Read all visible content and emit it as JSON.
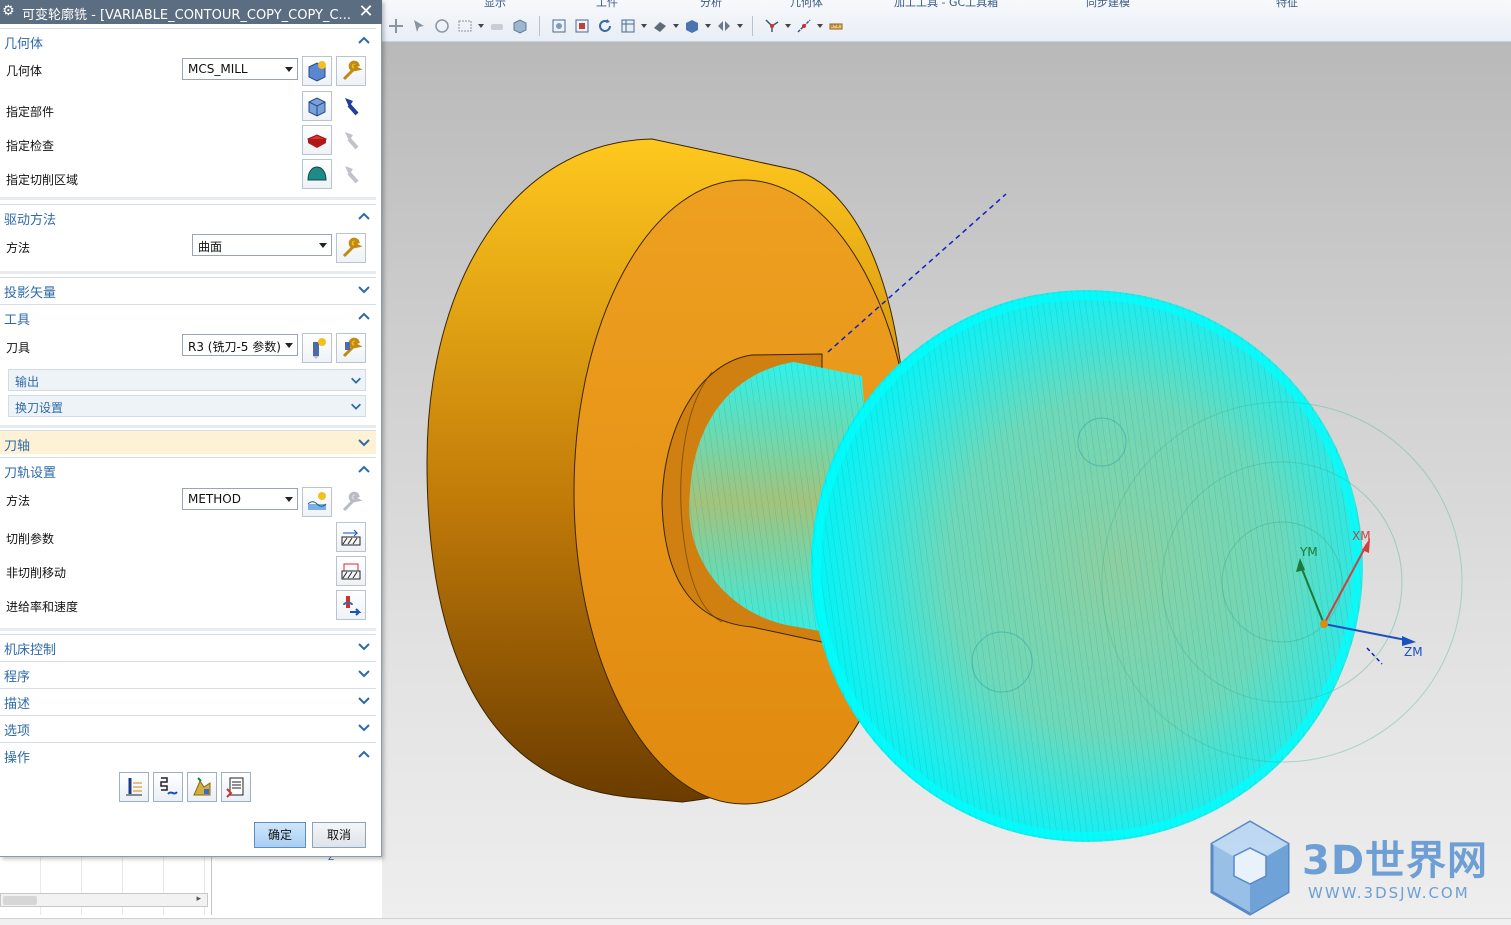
{
  "dialog": {
    "title": "可变轮廓铣 - [VARIABLE_CONTOUR_COPY_COPY_C...",
    "close_label": "✕",
    "sections": {
      "geometry": {
        "title": "几何体",
        "geometry_label": "几何体",
        "geometry_value": "MCS_MILL",
        "specify_part": "指定部件",
        "specify_check": "指定检查",
        "specify_cut_area": "指定切削区域"
      },
      "drive": {
        "title": "驱动方法",
        "method_label": "方法",
        "method_value": "曲面"
      },
      "projection": {
        "title": "投影矢量"
      },
      "tool": {
        "title": "工具",
        "tool_label": "刀具",
        "tool_value": "R3 (铣刀-5 参数)",
        "output": "输出",
        "tool_change": "换刀设置"
      },
      "tool_axis": {
        "title": "刀轴"
      },
      "path_settings": {
        "title": "刀轨设置",
        "method_label": "方法",
        "method_value": "METHOD",
        "cut_params": "切削参数",
        "non_cut_moves": "非切削移动",
        "feeds_speeds": "进给率和速度"
      },
      "machine_control": {
        "title": "机床控制"
      },
      "program": {
        "title": "程序"
      },
      "description": {
        "title": "描述"
      },
      "options": {
        "title": "选项"
      },
      "actions": {
        "title": "操作"
      }
    },
    "ok_label": "确定",
    "cancel_label": "取消"
  },
  "toolbar": {
    "group_tabs": [
      "显示",
      "工件",
      "分析",
      "几何体",
      "加工工具 - GC工具箱",
      "同步建模",
      "特征"
    ]
  },
  "viewport": {
    "csys_labels": {
      "x": "XM",
      "y": "YM",
      "z": "ZM"
    },
    "bottom_label": "Z"
  },
  "watermark": {
    "title": "3D世界网",
    "url": "WWW.3DSJW.COM"
  },
  "colors": {
    "accent": "#2f6aa8",
    "toolpath": "#00f0f0",
    "part": "#f0a010",
    "highlight_section": "#fdf2d6"
  }
}
